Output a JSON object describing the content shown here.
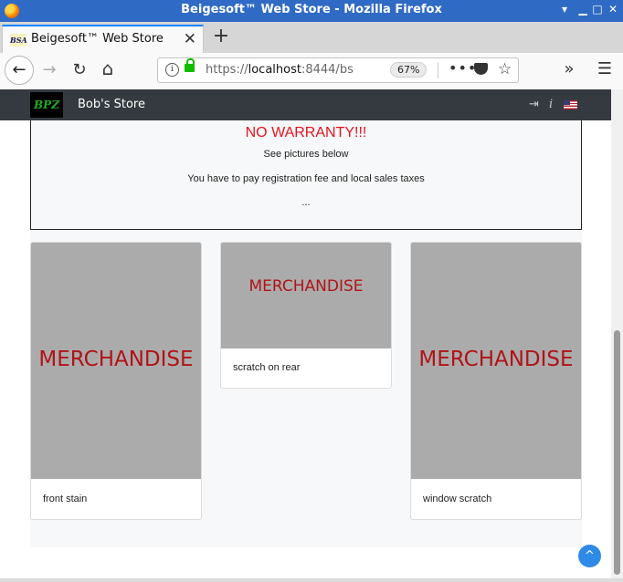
{
  "window": {
    "title": "Beigesoft™ Web Store - Mozilla Firefox",
    "controls": [
      "▾",
      "▁",
      "□",
      "✕"
    ]
  },
  "tabs": {
    "active_label": "Beigesoft™ Web Store",
    "favicon_text": "BSA",
    "close_glyph": "✕",
    "new_tab_glyph": "+"
  },
  "navbar": {
    "back_glyph": "←",
    "forward_glyph": "→",
    "reload_glyph": "↻",
    "home_glyph": "⌂",
    "url_prefix": "https://",
    "url_host": "localhost",
    "url_rest": ":8444/bs",
    "info_glyph": "i",
    "zoom": "67%",
    "more_glyph": "•••",
    "star_glyph": "☆",
    "overflow_glyph": "»",
    "menu_glyph": "☰"
  },
  "site": {
    "logo_text": "BPZ",
    "brand": "Bob's Store",
    "login_glyph": "⇥",
    "info_glyph": "i"
  },
  "notice": {
    "headline": "NO WARRANTY!!!",
    "line1": "See pictures below",
    "line2": "You have to pay registration fee and local sales taxes",
    "line3": "..."
  },
  "cards": [
    {
      "image_text": "MERCHANDISE",
      "caption": "front stain"
    },
    {
      "image_text": "MERCHANDISE",
      "caption": "scratch on rear"
    },
    {
      "image_text": "MERCHANDISE",
      "caption": "window scratch"
    }
  ],
  "scroll_top": {
    "glyph": "^"
  },
  "colors": {
    "titlebar": "#2f6bc4",
    "site_nav": "#343a40",
    "warning": "#e3141e",
    "merch_text": "#b01318",
    "image_placeholder": "#ababab",
    "scroll_top_button": "#2e8ae6"
  }
}
